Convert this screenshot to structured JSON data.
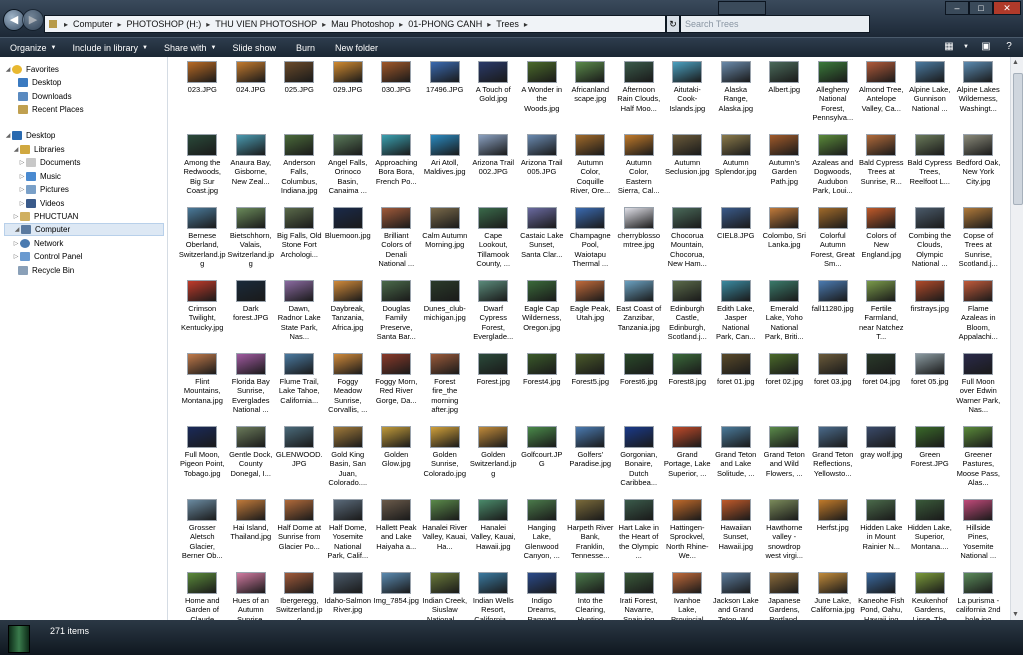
{
  "window": {
    "breadcrumb": [
      "Computer",
      "PHOTOSHOP (H:)",
      "THU VIEN PHOTOSHOP",
      "Mau Photoshop",
      "01-PHONG CANH",
      "Trees"
    ],
    "search_placeholder": "Search Trees"
  },
  "toolbar": {
    "organize": "Organize",
    "include_in_library": "Include in library",
    "share_with": "Share with",
    "slide_show": "Slide show",
    "burn": "Burn",
    "new_folder": "New folder"
  },
  "nav": {
    "favorites": "Favorites",
    "desktop": "Desktop",
    "downloads": "Downloads",
    "recent_places": "Recent Places",
    "desktop_root": "Desktop",
    "libraries": "Libraries",
    "documents": "Documents",
    "music": "Music",
    "pictures": "Pictures",
    "videos": "Videos",
    "phuctuan": "PHUCTUAN",
    "computer": "Computer",
    "network": "Network",
    "control_panel": "Control Panel",
    "recycle_bin": "Recycle Bin"
  },
  "files": [
    {
      "name": "023.JPG",
      "color": "#b86a24"
    },
    {
      "name": "024.JPG",
      "color": "#c27a2e"
    },
    {
      "name": "025.JPG",
      "color": "#6a4a2a"
    },
    {
      "name": "029.JPG",
      "color": "#d08a30"
    },
    {
      "name": "030.JPG",
      "color": "#a0582a"
    },
    {
      "name": "17496.JPG",
      "color": "#3a6ab0"
    },
    {
      "name": "A Touch of Gold.jpg",
      "color": "#2a3a6a"
    },
    {
      "name": "A Wonder in the Woods.jpg",
      "color": "#4a6a2a"
    },
    {
      "name": "Africanland scape.jpg",
      "color": "#5a8a4a"
    },
    {
      "name": "Afternoon Rain Clouds, Half Moo...",
      "color": "#3a5a4a"
    },
    {
      "name": "Aitutaki-Cook-Islands.jpg",
      "color": "#4aa0c0"
    },
    {
      "name": "Alaska Range, Alaska.jpg",
      "color": "#6a8aaa"
    },
    {
      "name": "Albert.jpg",
      "color": "#4a6a5a"
    },
    {
      "name": "Allegheny National Forest, Pennsylva...",
      "color": "#3a7a3a"
    },
    {
      "name": "Almond Tree, Antelope Valley, Ca...",
      "color": "#b05a3a"
    },
    {
      "name": "Alpine Lake, Gunnison National ...",
      "color": "#4a7aa0"
    },
    {
      "name": "Alpine Lakes Wilderness, Washingt...",
      "color": "#5a8ab0"
    },
    {
      "name": "Among the Redwoods, Big Sur Coast.jpg",
      "color": "#2a4a3a"
    },
    {
      "name": "Anaura Bay, Gisborne, New Zeal...",
      "color": "#4a9ab0"
    },
    {
      "name": "Anderson Falls, Columbus, Indiana.jpg",
      "color": "#4a6a3a"
    },
    {
      "name": "Angel Falls, Orinoco Basin, Canaima ...",
      "color": "#5a7a5a"
    },
    {
      "name": "Approaching Bora Bora, French Po...",
      "color": "#3aa0b0"
    },
    {
      "name": "Ari Atoll, Maldives.jpg",
      "color": "#2a8ac0"
    },
    {
      "name": "Arizona Trail 002.JPG",
      "color": "#8aa0c0"
    },
    {
      "name": "Arizona Trail 005.JPG",
      "color": "#6a8ab0"
    },
    {
      "name": "Autumn Color, Coquille River, Ore...",
      "color": "#a06a2a"
    },
    {
      "name": "Autumn Color, Eastern Sierra, Cal...",
      "color": "#c07a2a"
    },
    {
      "name": "Autumn Seclusion.jpg",
      "color": "#6a5a3a"
    },
    {
      "name": "Autumn Splendor.jpg",
      "color": "#8a7a4a"
    },
    {
      "name": "Autumn's Garden Path.jpg",
      "color": "#a05a2a"
    },
    {
      "name": "Azaleas and Dogwoods, Audubon Park, Loui...",
      "color": "#5a8a3a"
    },
    {
      "name": "Bald Cypress Trees at Sunrise, R...",
      "color": "#b06a3a"
    },
    {
      "name": "Bald Cypress Trees, Reelfoot L...",
      "color": "#6a7a5a"
    },
    {
      "name": "Bedford Oak, New York City.jpg",
      "color": "#8a8a7a"
    },
    {
      "name": "Bernese Oberland, Switzerland.jpg",
      "color": "#4a7a9a"
    },
    {
      "name": "Bietschhorn, Valais, Switzerland.jpg",
      "color": "#6a8a5a"
    },
    {
      "name": "Big Falls, Old Stone Fort Archologi...",
      "color": "#5a6a4a"
    },
    {
      "name": "Bluemoon.jpg",
      "color": "#1a2a4a"
    },
    {
      "name": "Brilliant Colors of Denali National ...",
      "color": "#a05a3a"
    },
    {
      "name": "Calm Autumn Morning.jpg",
      "color": "#7a6a4a"
    },
    {
      "name": "Cape Lookout, Tillamook County, ...",
      "color": "#3a6a4a"
    },
    {
      "name": "Castaic Lake Sunset, Santa Clar...",
      "color": "#6a6aa0"
    },
    {
      "name": "Champagne Pool, Waiotapu Thermal ...",
      "color": "#3a6ab0"
    },
    {
      "name": "cherryblossomtree.jpg",
      "color": "#e0e0e8"
    },
    {
      "name": "Chocorua Mountain, Chocorua, New Ham...",
      "color": "#4a6a5a"
    },
    {
      "name": "CIEL8.JPG",
      "color": "#3a5a8a"
    },
    {
      "name": "Colombo, Sri Lanka.jpg",
      "color": "#c07a3a"
    },
    {
      "name": "Colorful Autumn Forest, Great Sm...",
      "color": "#a06a2a"
    },
    {
      "name": "Colors of New England.jpg",
      "color": "#c05a2a"
    },
    {
      "name": "Combing the Clouds, Olympic National ...",
      "color": "#4a5a6a"
    },
    {
      "name": "Copse of Trees at Sunrise, Scotland.j...",
      "color": "#b07a3a"
    },
    {
      "name": "Crimson Twilight, Kentucky.jpg",
      "color": "#c03a2a"
    },
    {
      "name": "Dark forest.JPG",
      "color": "#1a2a3a"
    },
    {
      "name": "Dawn, Radnor Lake State Park, Nas...",
      "color": "#8a6aa0"
    },
    {
      "name": "Daybreak, Tanzania, Africa.jpg",
      "color": "#d08a3a"
    },
    {
      "name": "Douglas Family Preserve, Santa Bar...",
      "color": "#4a6a4a"
    },
    {
      "name": "Dunes_club-michigan.jpg",
      "color": "#2a3a2a"
    },
    {
      "name": "Dwarf Cypress Forest, Everglade...",
      "color": "#5a8a7a"
    },
    {
      "name": "Eagle Cap Wilderness, Oregon.jpg",
      "color": "#3a6a3a"
    },
    {
      "name": "Eagle Peak, Utah.jpg",
      "color": "#c06a3a"
    },
    {
      "name": "East Coast of Zanzibar, Tanzania.jpg",
      "color": "#6aa0c0"
    },
    {
      "name": "Edinburgh Castle, Edinburgh, Scotland.j...",
      "color": "#5a6a4a"
    },
    {
      "name": "Edith Lake, Jasper National Park, Can...",
      "color": "#3a8aa0"
    },
    {
      "name": "Emerald Lake, Yoho National Park, Briti...",
      "color": "#3a7a6a"
    },
    {
      "name": "fall11280.jpg",
      "color": "#4a7ab0"
    },
    {
      "name": "Fertile Farmland, near Natchez T...",
      "color": "#7a9a4a"
    },
    {
      "name": "firstrays.jpg",
      "color": "#b04a2a"
    },
    {
      "name": "Flame Azaleas in Bloom, Appalachi...",
      "color": "#c05a3a"
    },
    {
      "name": "Flint Mountains, Montana.jpg",
      "color": "#c07a4a"
    },
    {
      "name": "Florida Bay Sunrise, Everglades National ...",
      "color": "#a05aa0"
    },
    {
      "name": "Flume Trail, Lake Tahoe, California...",
      "color": "#4a7aa0"
    },
    {
      "name": "Foggy Meadow Sunrise, Corvallis, ...",
      "color": "#d08a3a"
    },
    {
      "name": "Foggy Morn, Red River Gorge, Da...",
      "color": "#8a3a2a"
    },
    {
      "name": "Forest fire_the morning after.jpg",
      "color": "#9a5a3a"
    },
    {
      "name": "Forest.jpg",
      "color": "#2a4a3a"
    },
    {
      "name": "Forest4.jpg",
      "color": "#3a5a2a"
    },
    {
      "name": "Forest5.jpg",
      "color": "#4a5a2a"
    },
    {
      "name": "Forest6.jpg",
      "color": "#2a4a2a"
    },
    {
      "name": "Forest8.jpg",
      "color": "#3a6a3a"
    },
    {
      "name": "foret 01.jpg",
      "color": "#5a4a2a"
    },
    {
      "name": "foret 02.jpg",
      "color": "#4a6a2a"
    },
    {
      "name": "foret 03.jpg",
      "color": "#6a5a3a"
    },
    {
      "name": "foret 04.jpg",
      "color": "#2a3a2a"
    },
    {
      "name": "foret 05.jpg",
      "color": "#8a9aa0"
    },
    {
      "name": "Full Moon over Edwin Warner Park, Nas...",
      "color": "#2a2a4a"
    },
    {
      "name": "Full Moon, Pigeon Point, Tobago.jpg",
      "color": "#1a2a5a"
    },
    {
      "name": "Gentle Dock, County Donegal, I...",
      "color": "#6a7a5a"
    },
    {
      "name": "GLENWOOD.JPG",
      "color": "#4a6a7a"
    },
    {
      "name": "Gold King Basin, San Juan, Colorado....",
      "color": "#a07a3a"
    },
    {
      "name": "Golden Glow.jpg",
      "color": "#c09a3a"
    },
    {
      "name": "Golden Sunrise, Colorado.jpg",
      "color": "#d0a03a"
    },
    {
      "name": "Golden Switzerland.jpg",
      "color": "#c08a3a"
    },
    {
      "name": "Golfcourt.JPG",
      "color": "#4a8a4a"
    },
    {
      "name": "Golfers' Paradise.jpg",
      "color": "#4a7ab0"
    },
    {
      "name": "Gorgonian, Bonaire, Dutch Caribbea...",
      "color": "#1a3a8a"
    },
    {
      "name": "Grand Portage, Lake Superior, ...",
      "color": "#c04a2a"
    },
    {
      "name": "Grand Teton and Lake Solitude, ...",
      "color": "#4a7a9a"
    },
    {
      "name": "Grand Teton and Wild Flowers, ...",
      "color": "#5a8a4a"
    },
    {
      "name": "Grand Teton Reflections, Yellowsto...",
      "color": "#4a6a8a"
    },
    {
      "name": "gray wolf.jpg",
      "color": "#3a4a6a"
    },
    {
      "name": "Green Forest.JPG",
      "color": "#3a6a2a"
    },
    {
      "name": "Greener Pastures, Moose Pass, Alas...",
      "color": "#5a8a3a"
    },
    {
      "name": "Grosser Aletsch Glacier, Berner Ob...",
      "color": "#6a8aa0"
    },
    {
      "name": "Hai Island, Thailand.jpg",
      "color": "#c07a3a"
    },
    {
      "name": "Half Dome at Sunrise from Glacier Po...",
      "color": "#b06a3a"
    },
    {
      "name": "Half Dome, Yosemite National Park, Calif...",
      "color": "#5a6a7a"
    },
    {
      "name": "Hallett Peak and Lake Haiyaha a...",
      "color": "#6a5a4a"
    },
    {
      "name": "Hanalei River Valley, Kauai, Ha...",
      "color": "#5a8a4a"
    },
    {
      "name": "Hanalei Valley, Kauai, Hawaii.jpg",
      "color": "#4a8a6a"
    },
    {
      "name": "Hanging Lake, Glenwood Canyon, ...",
      "color": "#4a7a4a"
    },
    {
      "name": "Harpeth River Bank, Franklin, Tennesse...",
      "color": "#7a6a3a"
    },
    {
      "name": "Hart Lake in the Heart of the Olympic ...",
      "color": "#3a5a4a"
    },
    {
      "name": "Hattingen-Sprockvel, North Rhine-We...",
      "color": "#c06a2a"
    },
    {
      "name": "Hawaiian Sunset, Hawaii.jpg",
      "color": "#c05a2a"
    },
    {
      "name": "Hawthorne valley - snowdrop west virgi...",
      "color": "#7a8a5a"
    },
    {
      "name": "Herfst.jpg",
      "color": "#c07a2a"
    },
    {
      "name": "Hidden Lake in Mount Rainier N...",
      "color": "#4a6a4a"
    },
    {
      "name": "Hidden Lake, Superior, Montana....",
      "color": "#3a5a3a"
    },
    {
      "name": "Hillside Pines, Yosemite National ...",
      "color": "#c04a7a"
    },
    {
      "name": "Home and Garden of Claude Monet, Gi...",
      "color": "#5a8a3a"
    },
    {
      "name": "Hues of an Autumn Sunrise, Mount Ba...",
      "color": "#d07aa0"
    },
    {
      "name": "Ibergeregg, Switzerland.jpg",
      "color": "#a05a3a"
    },
    {
      "name": "Idaho-Salmon River.jpg",
      "color": "#4a5a6a"
    },
    {
      "name": "Img_7854.jpg",
      "color": "#5a8ab0"
    },
    {
      "name": "Indian Creek, Siuslaw National ...",
      "color": "#6a7a3a"
    },
    {
      "name": "Indian Wells Resort, California...",
      "color": "#3a7aa0"
    },
    {
      "name": "Indigo Dreams, Rampart Lakes, We...",
      "color": "#2a4a8a"
    },
    {
      "name": "Into the Clearing, Hunting Valley, Oh...",
      "color": "#4a7a4a"
    },
    {
      "name": "Irati Forest, Navarre, Spain.jpg",
      "color": "#3a5a3a"
    },
    {
      "name": "Ivanhoe Lake, Provincial Park, Ont...",
      "color": "#c06a3a"
    },
    {
      "name": "Jackson Lake and Grand Teton, W...",
      "color": "#5a7a9a"
    },
    {
      "name": "Japanese Gardens, Portland, Oregon.jpg",
      "color": "#8a6a3a"
    },
    {
      "name": "June Lake, California.jpg",
      "color": "#c08a3a"
    },
    {
      "name": "Kaneohe Fish Pond, Oahu, Hawaii.jpg",
      "color": "#3a6aa0"
    },
    {
      "name": "Keukenhof Gardens, Lisse, The Netherlan...",
      "color": "#7a9a3a"
    },
    {
      "name": "La purisma - california 2nd hole.jpg",
      "color": "#5a8a5a"
    }
  ],
  "status": {
    "item_count": "271 items"
  }
}
